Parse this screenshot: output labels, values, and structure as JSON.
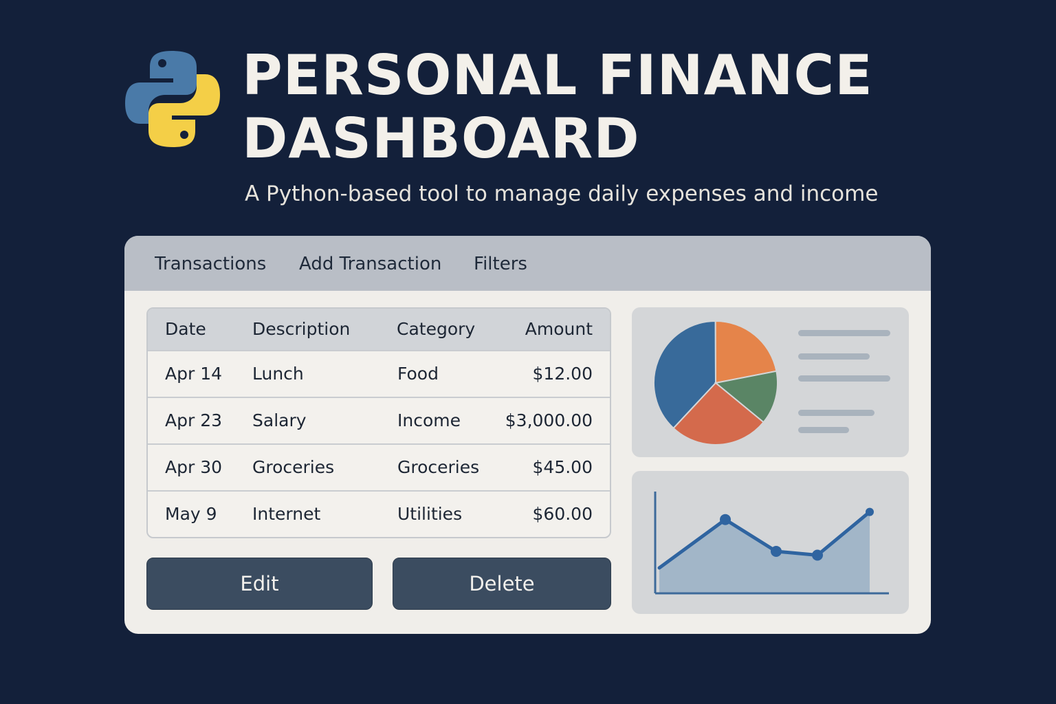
{
  "header": {
    "logo_icon": "python-logo-icon",
    "title_line1": "PERSONAL FINANCE",
    "title_line2": "DASHBOARD",
    "subtitle": "A Python-based tool to manage daily expenses and income"
  },
  "tabs": [
    {
      "label": "Transactions"
    },
    {
      "label": "Add Transaction"
    },
    {
      "label": "Filters"
    }
  ],
  "table": {
    "columns": [
      "Date",
      "Description",
      "Category",
      "Amount"
    ],
    "rows": [
      [
        "Apr 14",
        "Lunch",
        "Food",
        "$12.00"
      ],
      [
        "Apr 23",
        "Salary",
        "Income",
        "$3,000.00"
      ],
      [
        "Apr 30",
        "Groceries",
        "Groceries",
        "$45.00"
      ],
      [
        "May 9",
        "Internet",
        "Utilities",
        "$60.00"
      ]
    ]
  },
  "buttons": {
    "edit": "Edit",
    "delete": "Delete"
  },
  "colors": {
    "background": "#13203a",
    "button": "#3b4c60",
    "pie_blue": "#386a9a",
    "pie_orange": "#e5844a",
    "pie_green": "#5a8565",
    "pie_red": "#d46a4c",
    "line": "#2f64a0",
    "area": "#a2b6c8"
  },
  "chart_data": [
    {
      "type": "pie",
      "values": [
        38,
        22,
        14,
        26
      ],
      "colors": [
        "#386a9a",
        "#e5844a",
        "#5a8565",
        "#d46a4c"
      ],
      "legend": "right"
    },
    {
      "type": "area",
      "x": [
        0,
        1,
        2,
        3,
        4
      ],
      "y": [
        2,
        5.8,
        3.3,
        3,
        6.4
      ],
      "ylim": [
        0,
        8
      ],
      "grid": false
    }
  ]
}
